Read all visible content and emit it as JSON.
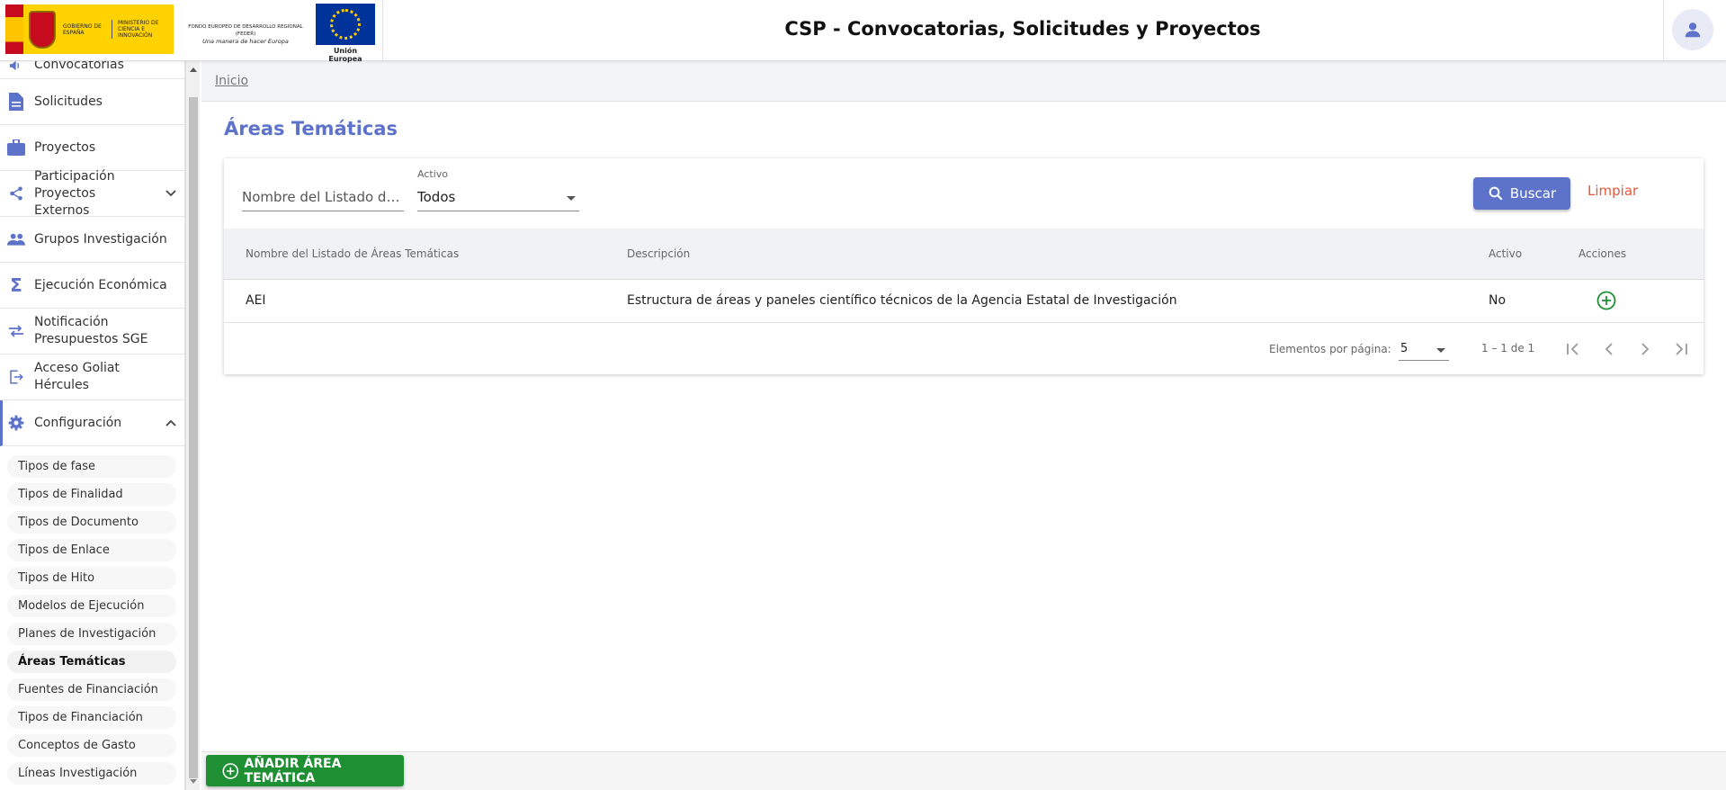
{
  "header": {
    "title": "CSP - Convocatorias, Solicitudes y Proyectos",
    "logo_gobierno": "GOBIERNO DE ESPAÑA",
    "logo_ministerio": "MINISTERIO DE CIENCIA E INNOVACIÓN",
    "logo_feder_line1": "FONDO EUROPEO DE DESARROLLO REGIONAL (FEDER)",
    "logo_feder_line2": "Una manera de hacer Europa",
    "logo_eu": "Unión Europea",
    "user_icon": "user-icon"
  },
  "sidebar": {
    "items": [
      {
        "label": "Convocatorias",
        "icon": "megaphone-icon"
      },
      {
        "label": "Solicitudes",
        "icon": "document-icon"
      },
      {
        "label": "Proyectos",
        "icon": "briefcase-icon"
      },
      {
        "label": "Participación Proyectos Externos",
        "icon": "share-icon"
      },
      {
        "label": "Grupos Investigación",
        "icon": "people-icon"
      },
      {
        "label": "Ejecución Económica",
        "icon": "sigma-icon"
      },
      {
        "label": "Notificación Presupuestos SGE",
        "icon": "swap-icon"
      },
      {
        "label": "Acceso Goliat Hércules",
        "icon": "exit-icon"
      },
      {
        "label": "Configuración",
        "icon": "gear-icon"
      }
    ],
    "config_items": [
      "Tipos de fase",
      "Tipos de Finalidad",
      "Tipos de Documento",
      "Tipos de Enlace",
      "Tipos de Hito",
      "Modelos de Ejecución",
      "Planes de Investigación",
      "Áreas Temáticas",
      "Fuentes de Financiación",
      "Tipos de Financiación",
      "Conceptos de Gasto",
      "Líneas Investigación"
    ]
  },
  "breadcrumb": "Inicio",
  "page_title": "Áreas Temáticas",
  "filters": {
    "name_placeholder": "Nombre del Listado de Á...",
    "activo_label": "Activo",
    "activo_value": "Todos",
    "search_button": "Buscar",
    "clear_button": "Limpiar"
  },
  "table": {
    "headers": [
      "Nombre del Listado de Áreas Temáticas",
      "Descripción",
      "Activo",
      "Acciones"
    ],
    "rows": [
      {
        "nombre": "AEI",
        "descripcion": "Estructura de áreas y paneles científico técnicos de la Agencia Estatal de Investigación",
        "activo": "No"
      }
    ]
  },
  "paginator": {
    "label": "Elementos por página:",
    "page_size": "5",
    "range": "1 – 1 de 1"
  },
  "footer": {
    "add_button": "AÑADIR ÁREA TEMÁTICA"
  },
  "colors": {
    "accent": "#5c73c9",
    "success": "#1e8f32",
    "danger": "#e4573b"
  }
}
